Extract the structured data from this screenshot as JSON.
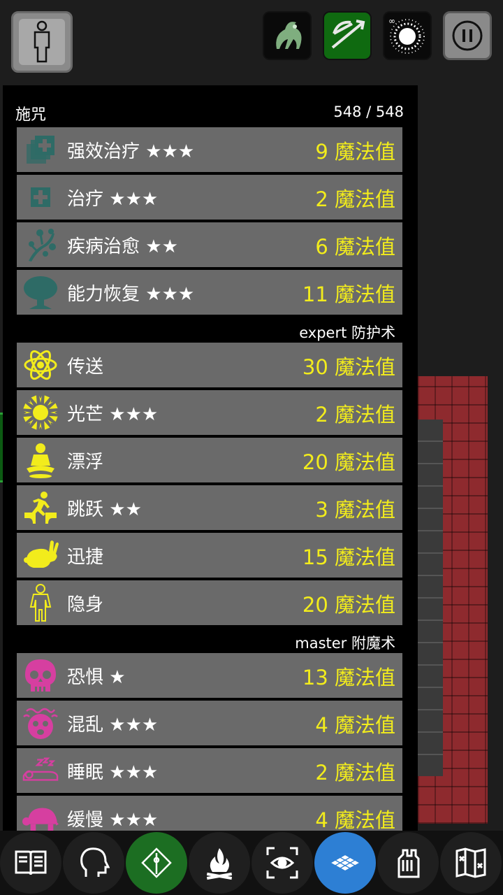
{
  "panel": {
    "title": "施咒",
    "mana": "548 / 548"
  },
  "groups": [
    {
      "school": "",
      "spells": [
        {
          "name": "强效治疗 ★★★",
          "cost": "9 魔法值",
          "icon": "greater-heal-icon",
          "color": "#2e6b66"
        },
        {
          "name": "治疗 ★★★",
          "cost": "2 魔法值",
          "icon": "heal-icon",
          "color": "#2e6b66"
        },
        {
          "name": "疾病治愈 ★★",
          "cost": "6 魔法值",
          "icon": "cure-disease-icon",
          "color": "#2e6b66"
        },
        {
          "name": "能力恢复 ★★★",
          "cost": "11 魔法值",
          "icon": "restore-ability-icon",
          "color": "#2e6b66"
        }
      ]
    },
    {
      "school": "expert 防护术",
      "spells": [
        {
          "name": "传送",
          "cost": "30 魔法值",
          "icon": "teleport-atom-icon",
          "color": "#f2ec1c"
        },
        {
          "name": "光芒 ★★★",
          "cost": "2 魔法值",
          "icon": "light-sun-icon",
          "color": "#f2ec1c"
        },
        {
          "name": "漂浮",
          "cost": "20 魔法值",
          "icon": "levitate-icon",
          "color": "#f2ec1c"
        },
        {
          "name": "跳跃 ★★",
          "cost": "3 魔法值",
          "icon": "jump-icon",
          "color": "#f2ec1c"
        },
        {
          "name": "迅捷",
          "cost": "15 魔法值",
          "icon": "haste-rabbit-icon",
          "color": "#f2ec1c"
        },
        {
          "name": "隐身",
          "cost": "20 魔法值",
          "icon": "invisibility-icon",
          "color": "#f2ec1c"
        }
      ]
    },
    {
      "school": "master 附魔术",
      "spells": [
        {
          "name": "恐惧 ★",
          "cost": "13 魔法值",
          "icon": "fear-skull-icon",
          "color": "#d63fa0"
        },
        {
          "name": "混乱 ★★★",
          "cost": "4 魔法值",
          "icon": "confusion-icon",
          "color": "#d63fa0"
        },
        {
          "name": "睡眠 ★★★",
          "cost": "2 魔法值",
          "icon": "sleep-icon",
          "color": "#d63fa0"
        },
        {
          "name": "缓慢 ★★★",
          "cost": "4 魔法值",
          "icon": "slow-turtle-icon",
          "color": "#d63fa0"
        }
      ]
    }
  ],
  "toolbar": {
    "items": [
      "spellbook-icon",
      "head-profile-icon",
      "cast-spell-icon",
      "campfire-icon",
      "search-eye-icon",
      "map-grid-icon",
      "inventory-hand-icon",
      "dungeon-map-icon"
    ],
    "active_color": "#1c6e22",
    "highlight_color": "#2d7fd4"
  }
}
